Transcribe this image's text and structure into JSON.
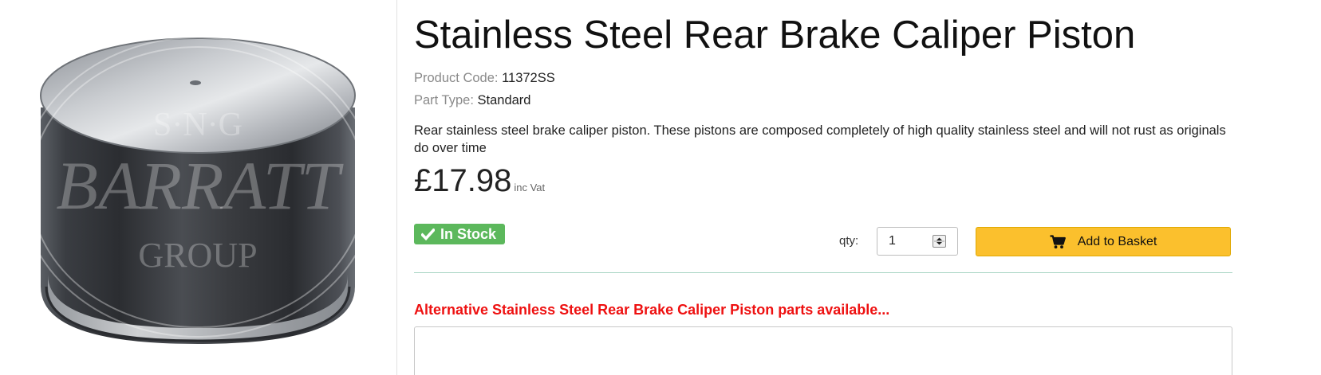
{
  "product": {
    "title": "Stainless Steel Rear Brake Caliper Piston",
    "code_label": "Product Code:",
    "code_value": "11372SS",
    "type_label": "Part Type:",
    "type_value": "Standard",
    "description": "Rear stainless steel brake caliper piston. These pistons are composed completely of high quality stainless steel and will not rust as originals do over time",
    "price": "£17.98",
    "vat_label": "inc Vat",
    "image_watermark": {
      "line1": "S·N·G",
      "line2": "BARRATT",
      "line3": "GROUP"
    }
  },
  "stock": {
    "label": "In Stock",
    "color": "#5cb85c"
  },
  "purchase": {
    "qty_label": "qty:",
    "qty_value": "1",
    "add_label": "Add to Basket",
    "button_color": "#fbc02d"
  },
  "alternatives": {
    "heading": "Alternative Stainless Steel Rear Brake Caliper Piston parts available...",
    "heading_color": "#ee1111"
  },
  "icons": {
    "stock_icon": "check-icon",
    "basket_icon": "shopping-cart-icon",
    "spinner_icon": "up-down-arrows-icon"
  }
}
